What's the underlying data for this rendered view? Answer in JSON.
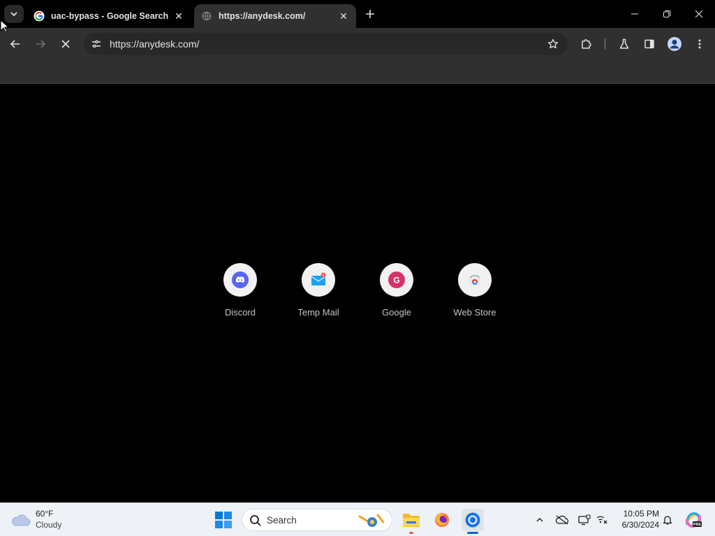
{
  "browser": {
    "tabs": [
      {
        "title": "uac-bypass - Google Search",
        "favicon": "google-g-icon",
        "active": false
      },
      {
        "title": "https://anydesk.com/",
        "favicon": "loading-globe-icon",
        "active": true
      }
    ],
    "url": "https://anydesk.com/"
  },
  "shortcuts": [
    {
      "label": "Discord",
      "icon": "discord-icon",
      "color": "#5865f2"
    },
    {
      "label": "Temp Mail",
      "icon": "temp-mail-icon",
      "color": "#1ea1f2"
    },
    {
      "label": "Google",
      "icon": "google-icon",
      "letter": "G",
      "color": "#d6336c"
    },
    {
      "label": "Web Store",
      "icon": "web-store-icon",
      "color": "#4285f4"
    }
  ],
  "taskbar": {
    "weather": {
      "temp": "60°F",
      "condition": "Cloudy"
    },
    "search_placeholder": "Search",
    "clock": {
      "time": "10:05 PM",
      "date": "6/30/2024"
    }
  },
  "colors": {
    "accent": "#0067c0",
    "toolbar": "#303030",
    "tab_active": "#303030"
  }
}
